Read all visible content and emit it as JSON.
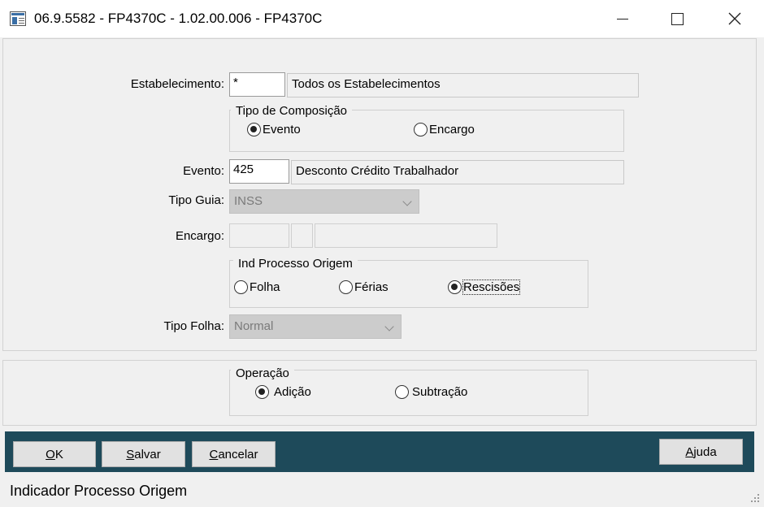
{
  "window": {
    "title": "06.9.5582 - FP4370C - 1.02.00.006 - FP4370C",
    "controls": [
      "minimize-icon",
      "maximize-icon",
      "close-icon"
    ]
  },
  "estabelecimento": {
    "label": "Estabelecimento:",
    "code": "*",
    "description": "Todos os Estabelecimentos"
  },
  "tipo_composicao": {
    "title": "Tipo de Composição",
    "options": [
      {
        "label": "Evento",
        "selected": true
      },
      {
        "label": "Encargo",
        "selected": false
      }
    ]
  },
  "evento": {
    "label": "Evento:",
    "code": "425",
    "description": "Desconto Crédito Trabalhador"
  },
  "tipo_guia": {
    "label": "Tipo Guia:",
    "value": "INSS"
  },
  "encargo": {
    "label": "Encargo:",
    "code": "",
    "sub": "",
    "description": ""
  },
  "ind_processo": {
    "title": "Ind Processo Origem",
    "options": [
      {
        "label": "Folha",
        "selected": false
      },
      {
        "label": "Férias",
        "selected": false
      },
      {
        "label": "Rescisões",
        "selected": true
      }
    ]
  },
  "tipo_folha": {
    "label": "Tipo Folha:",
    "value": "Normal"
  },
  "operacao": {
    "title": "Operação",
    "options": [
      {
        "label": "Adição",
        "selected": true
      },
      {
        "label": "Subtração",
        "selected": false
      }
    ]
  },
  "buttons": {
    "ok": {
      "first": "O",
      "rest": "K"
    },
    "salvar": {
      "first": "S",
      "rest": "alvar"
    },
    "cancelar": {
      "first": "C",
      "rest": "ancelar"
    },
    "ajuda": {
      "first": "A",
      "rest": "juda"
    }
  },
  "status_text": "Indicador Processo Origem",
  "colors": {
    "button_bar": "#1e4a5a",
    "background": "#f0f0f0"
  }
}
